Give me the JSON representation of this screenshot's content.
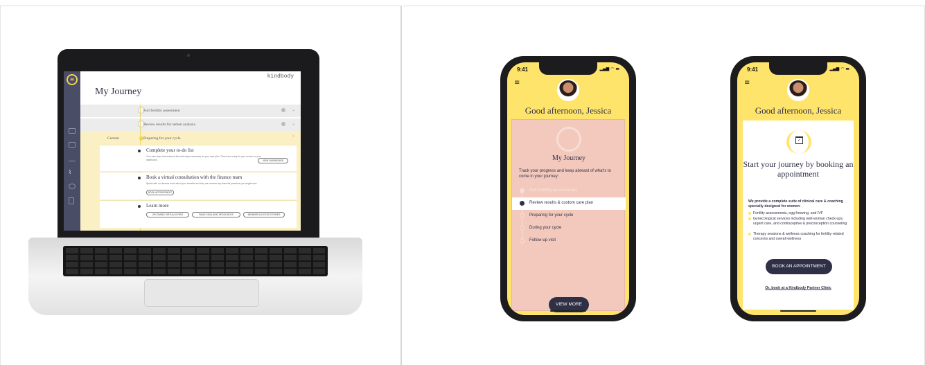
{
  "laptop": {
    "brand": "kindbody",
    "title": "My Journey",
    "rows": [
      {
        "label": "Full fertility assessment"
      },
      {
        "label": "Review results for semen analysis"
      },
      {
        "label": "Preparing for your cycle",
        "tag": "Current"
      }
    ],
    "tasks": [
      {
        "title": "Complete your to-do list",
        "desc": "Your care team has selected the best steps necessary for your care plan. These are ready for your review on your dashboard.",
        "buttons": [
          "VIEW DASHBOARD"
        ]
      },
      {
        "title": "Book a virtual consultation with the finance team",
        "desc": "Speak with our finance team about your benefits and they can answer any financial questions you might have.",
        "buttons": [
          "BOOK APPOINTMENT"
        ]
      },
      {
        "title": "Learn more",
        "desc": "",
        "buttons": [
          "UPCOMING VIRTUAL EVENT",
          "FAMILY BUILDING RESOURCES",
          "MEMBER SUCCESS STORIES"
        ]
      }
    ],
    "sidebar_icons": [
      "logo-icon",
      "dashboard-icon",
      "calendar-icon",
      "chart-icon",
      "journey-icon",
      "chat-icon",
      "document-icon"
    ]
  },
  "phone1": {
    "time": "9:41",
    "status": "▂▄▆ ◠ ▬",
    "menu": "≡",
    "greeting": "Good afternoon, Jessica",
    "journey_title": "My Journey",
    "description": "Track your progress and keep abreast of what's to come in your journey:",
    "steps": [
      {
        "label": "Full fertility assessment",
        "state": "done"
      },
      {
        "label": "Review results & custom care plan",
        "state": "active"
      },
      {
        "label": "Preparing for your cycle",
        "state": "upcoming"
      },
      {
        "label": "During your cycle",
        "state": "upcoming"
      },
      {
        "label": "Follow-up visit",
        "state": "upcoming"
      }
    ],
    "button": "VIEW MORE"
  },
  "phone2": {
    "time": "9:41",
    "status": "▂▄▆ ◠ ▬",
    "menu": "≡",
    "greeting": "Good afternoon, Jessica",
    "cal_glyph": "✓",
    "title": "Start your journey by booking an appointment",
    "intro": "We provide a complete suite of clinical care & coaching specially designed for women:",
    "bullets": [
      "Fertility assessments, egg freezing, and IVF",
      "Gynecological services including well-woman check-ups, urgent care, and contraceptive & preconception counseling",
      "Therapy sessions & wellness coaching for fertility-related concerns and overall wellness"
    ],
    "button": "BOOK AN APPOINTMENT",
    "link": "Or, book at a Kindbody Partner Clinic"
  },
  "colors": {
    "accent_yellow": "#ffe46c",
    "navy": "#2f3046",
    "pink": "#f3c9bd",
    "sidebar": "#4a4d66"
  }
}
